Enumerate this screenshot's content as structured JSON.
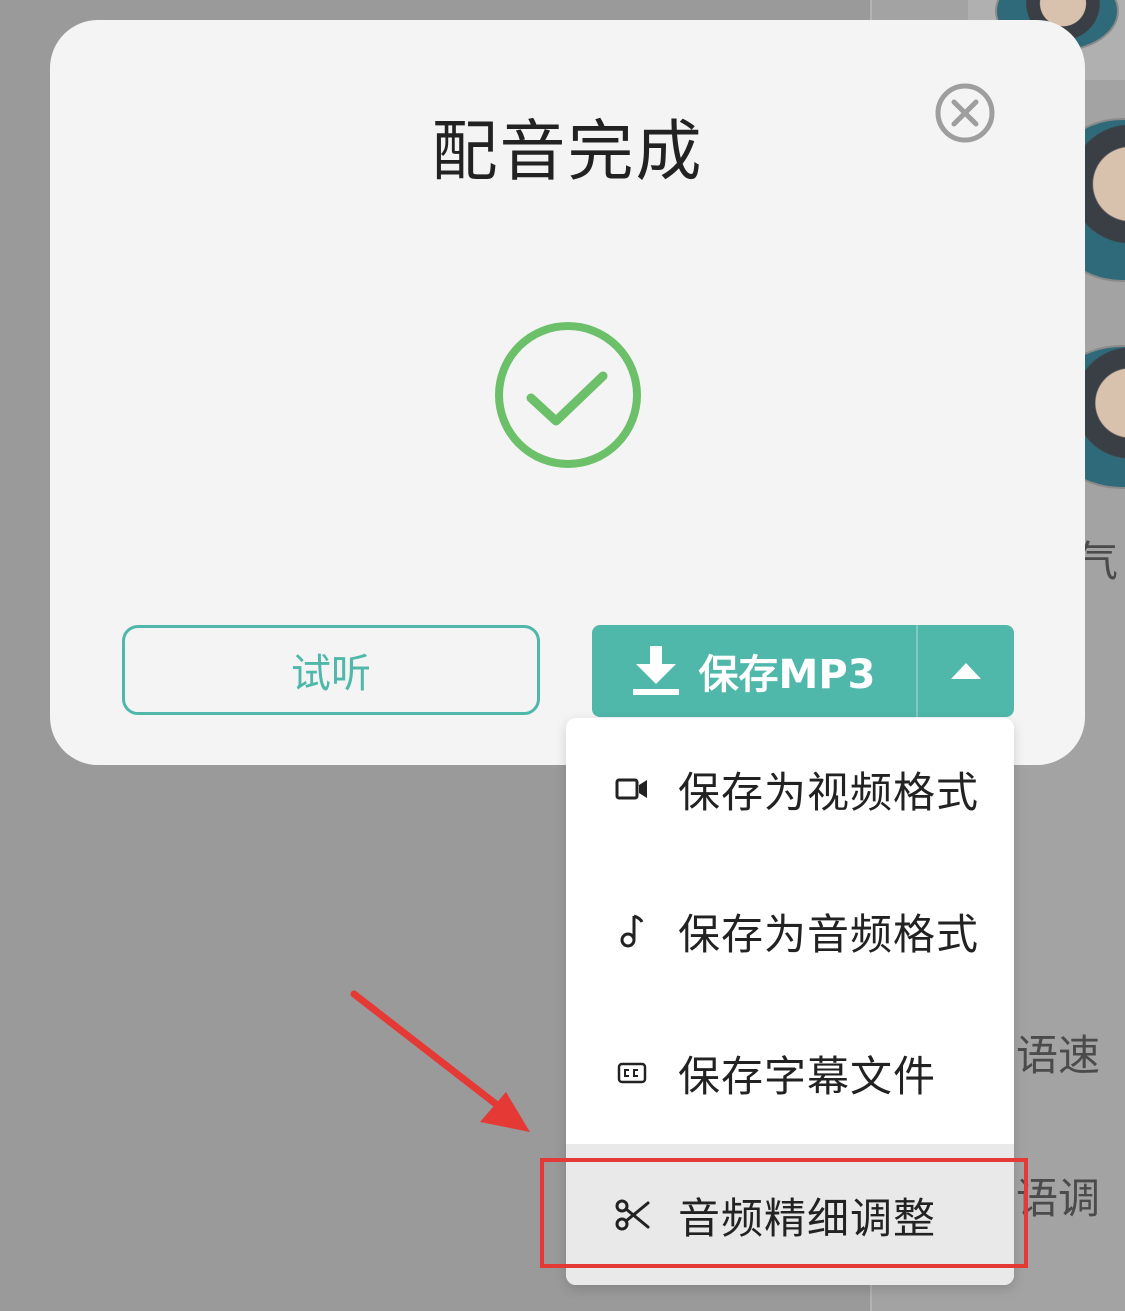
{
  "modal": {
    "title": "配音完成",
    "preview_label": "试听",
    "save_label": "保存MP3"
  },
  "menu": {
    "items": [
      {
        "label": "保存为视频格式",
        "icon": "video-camera-icon"
      },
      {
        "label": "保存为音频格式",
        "icon": "music-note-icon"
      },
      {
        "label": "保存字幕文件",
        "icon": "closed-caption-icon"
      },
      {
        "label": "音频精细调整",
        "icon": "scissors-icon",
        "active": true
      }
    ]
  },
  "background": {
    "labels": [
      "语速",
      "语调",
      "气"
    ]
  },
  "colors": {
    "accent": "#4fb8ab",
    "success": "#6cc06a",
    "annotation": "#e53935"
  }
}
